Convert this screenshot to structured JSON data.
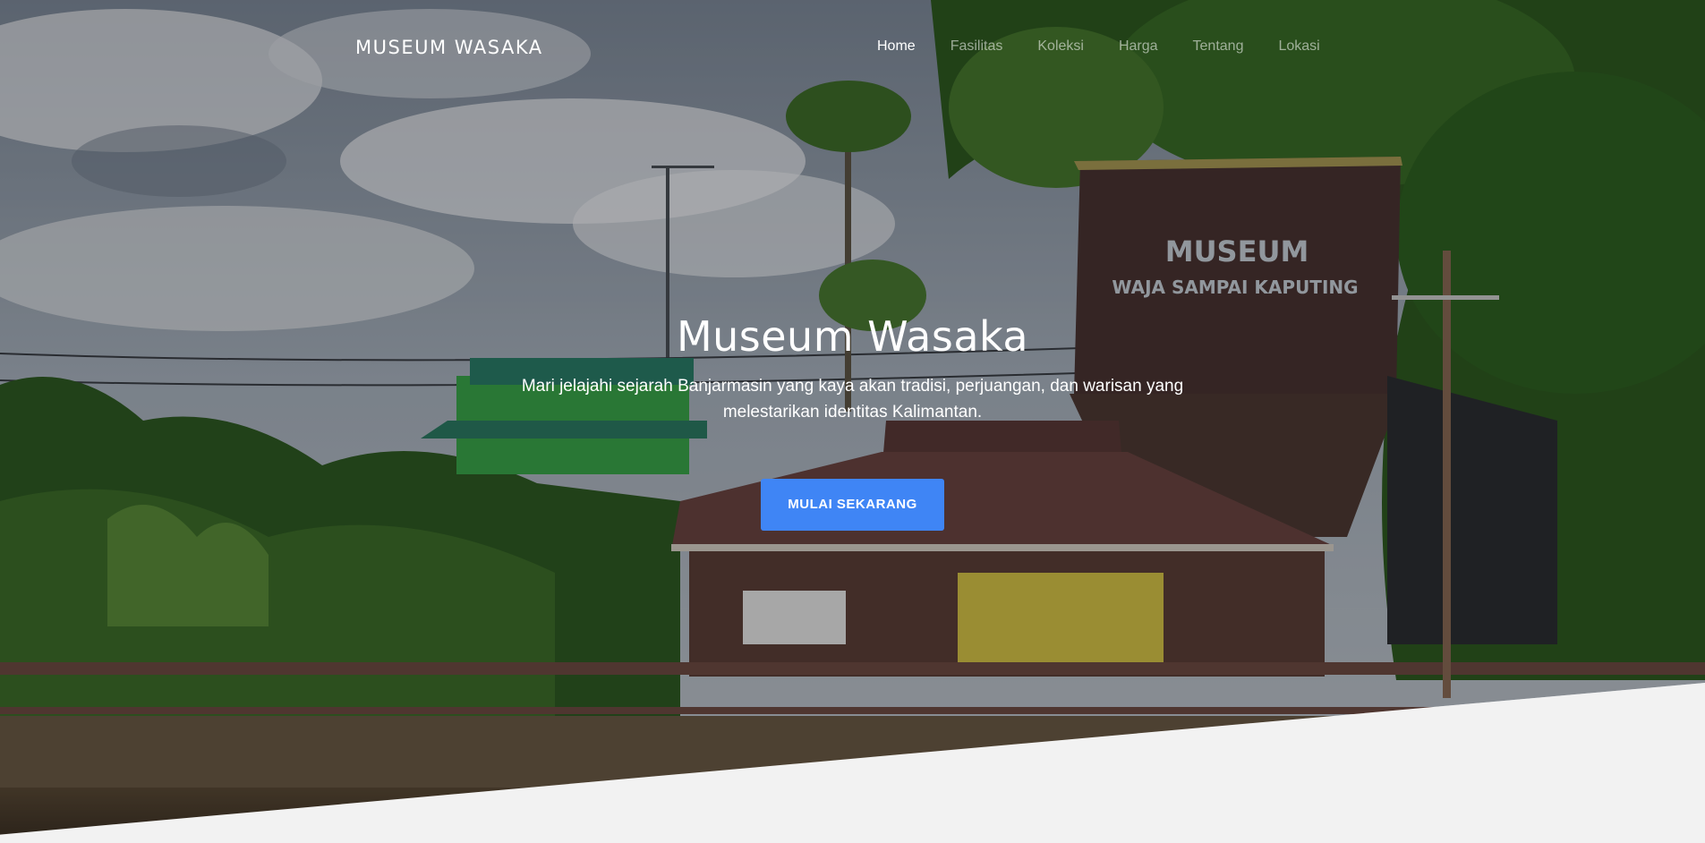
{
  "brand": "MUSEUM WASAKA",
  "nav": {
    "items": [
      {
        "label": "Home",
        "active": true
      },
      {
        "label": "Fasilitas",
        "active": false
      },
      {
        "label": "Koleksi",
        "active": false
      },
      {
        "label": "Harga",
        "active": false
      },
      {
        "label": "Tentang",
        "active": false
      },
      {
        "label": "Lokasi",
        "active": false
      }
    ]
  },
  "hero": {
    "title": "Museum Wasaka",
    "subtitle": "Mari jelajahi sejarah Banjarmasin yang kaya akan tradisi, perjuangan, dan warisan yang melestarikan identitas Kalimantan.",
    "cta_label": "MULAI SEKARANG",
    "photo_sign_line1": "MUSEUM",
    "photo_sign_line2": "WAJA SAMPAI KAPUTING"
  },
  "colors": {
    "accent": "#3f85f5",
    "section_bg": "#f2f2f2"
  }
}
